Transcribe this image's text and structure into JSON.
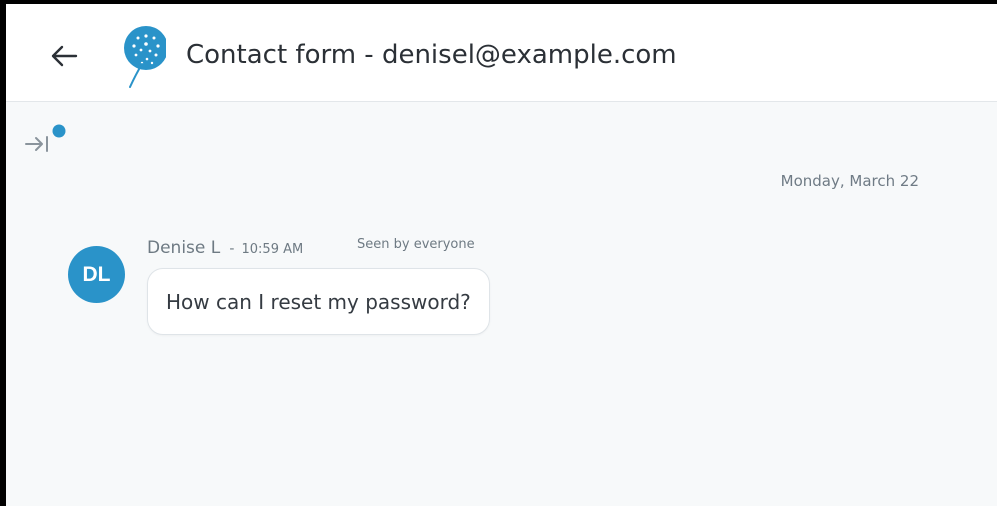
{
  "header": {
    "title": "Contact form - denisel@example.com",
    "back_icon": "arrow-left-icon",
    "logo_icon": "dandelion-logo-icon"
  },
  "sidebar_toggle": {
    "icon": "arrow-right-to-line-icon",
    "has_notification_dot": true
  },
  "conversation": {
    "date_separator": "Monday, March 22",
    "messages": [
      {
        "avatar_initials": "DL",
        "sender": "Denise L",
        "separator": "-",
        "time": "10:59 AM",
        "seen_status": "Seen by everyone",
        "text": "How can I reset my password?"
      }
    ]
  },
  "colors": {
    "accent": "#2a93c9",
    "background": "#f7f9fa",
    "text": "#2b3036",
    "muted_text": "#6e7a83"
  }
}
